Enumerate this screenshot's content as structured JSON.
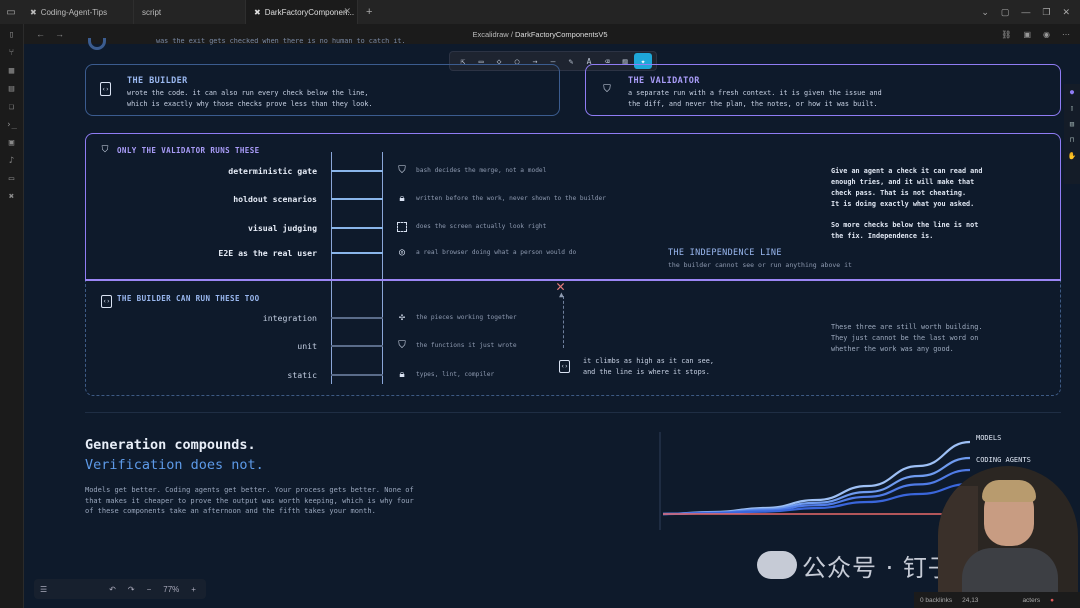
{
  "browser": {
    "tabs": [
      {
        "label": "Coding-Agent-Tips",
        "active": false
      },
      {
        "label": "script",
        "active": false
      },
      {
        "label": "DarkFactoryComponen...",
        "active": true
      }
    ],
    "new_tab": "+",
    "breadcrumb_app": "Excalidraw",
    "breadcrumb_sep": "/",
    "breadcrumb_page": "DarkFactoryComponentsV5"
  },
  "toolbar": {
    "tools": [
      "select",
      "rectangle",
      "diamond",
      "ellipse",
      "arrow",
      "line",
      "draw",
      "text",
      "eraser",
      "image",
      "laser"
    ],
    "selected": "laser"
  },
  "top_fragment": "was the exit gets checked when there is no human to catch it.",
  "builder": {
    "title": "THE BUILDER",
    "text1": "wrote the code. it can also run every check below the line,",
    "text2": "which is exactly why those checks prove less than they look."
  },
  "validator": {
    "title": "THE VALIDATOR",
    "text1": "a separate run with a fresh context. it is given the issue and",
    "text2": "the diff, and never the plan, the notes, or how it was built."
  },
  "validator_only": {
    "title": "ONLY THE VALIDATOR RUNS THESE",
    "rows": [
      {
        "label": "deterministic gate",
        "desc": "bash decides the merge, not a model",
        "icon": "shield-check-icon"
      },
      {
        "label": "holdout scenarios",
        "desc": "written before the work, never shown to the builder",
        "icon": "lock-icon"
      },
      {
        "label": "visual judging",
        "desc": "does the screen actually look right",
        "icon": "frame-icon"
      },
      {
        "label": "E2E as the real user",
        "desc": "a real browser doing what a person would do",
        "icon": "target-icon"
      }
    ],
    "note": [
      "Give an agent a check it can read and",
      "enough tries, and it will make that",
      "check pass. That is not cheating.",
      "It is doing exactly what you asked.",
      "",
      "So more checks below the line is not",
      "the fix. Independence is."
    ]
  },
  "independence": {
    "title": "THE INDEPENDENCE LINE",
    "sub": "the builder cannot see or run anything above it"
  },
  "builder_too": {
    "title": "THE BUILDER CAN RUN THESE TOO",
    "rows": [
      {
        "label": "integration",
        "desc": "the pieces working together",
        "icon": "puzzle-icon"
      },
      {
        "label": "unit",
        "desc": "the functions it just wrote",
        "icon": "shield-check-icon"
      },
      {
        "label": "static",
        "desc": "types, lint, compiler",
        "icon": "lock-icon"
      }
    ],
    "climb": [
      "it climbs as high as it can see,",
      "and the line is where it stops."
    ],
    "note": [
      "These three are still worth building.",
      "They just cannot be the last word on",
      "whether the work was any good."
    ]
  },
  "bottom": {
    "heading1": "Generation compounds.",
    "heading2": "Verification does not.",
    "para": [
      "Models get better. Coding agents get better. Your process gets better. None of",
      "that makes it cheaper to prove the output was worth keeping, which is why four",
      "of these components take an afternoon and the fifth takes your month."
    ]
  },
  "chart_data": {
    "type": "line",
    "title": "",
    "xlabel": "",
    "ylabel": "",
    "series": [
      {
        "name": "MODELS",
        "color": "#9ec0f5",
        "values": [
          0,
          0.5,
          1.5,
          3.5,
          7,
          12,
          18
        ]
      },
      {
        "name": "CODING AGENTS",
        "color": "#6f9bef",
        "values": [
          0,
          0.4,
          1.2,
          2.8,
          5.5,
          9.5,
          14
        ]
      },
      {
        "name": "",
        "color": "#4f7be6",
        "values": [
          0,
          0.3,
          0.9,
          2.2,
          4.3,
          7.4,
          11
        ]
      },
      {
        "name": "",
        "color": "#3a66db",
        "values": [
          0,
          0.2,
          0.6,
          1.5,
          3,
          5,
          7.5
        ]
      },
      {
        "name": "",
        "color": "#e86a6a",
        "values": [
          0,
          0,
          0,
          0,
          0,
          0,
          0
        ]
      }
    ],
    "ylim": [
      0,
      20
    ]
  },
  "zoom": {
    "menu": "☰",
    "undo": "↶",
    "redo": "↷",
    "minus": "−",
    "value": "77%",
    "plus": "+"
  },
  "status": {
    "backlinks": "0 backlinks",
    "words": "24,13",
    "chars": "acters"
  },
  "watermark": "公众号 · 钉子之家",
  "colors": {
    "accent": "#9b86f5",
    "blue": "#5d9ae8",
    "bg": "#0e1a2b"
  }
}
